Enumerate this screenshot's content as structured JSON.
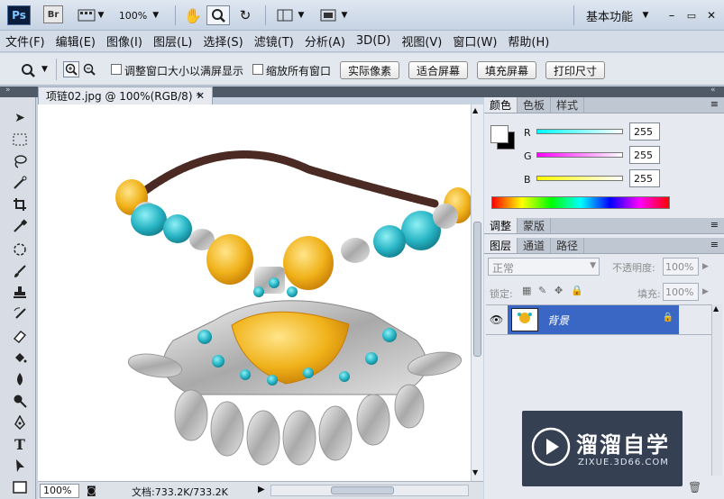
{
  "titlebar": {
    "ps_logo": "Ps",
    "br_logo": "Br",
    "zoom_value": "100%",
    "workspace_label": "基本功能",
    "window_controls": [
      "–",
      "▭",
      "✕"
    ]
  },
  "menu": [
    "文件(F)",
    "编辑(E)",
    "图像(I)",
    "图层(L)",
    "选择(S)",
    "滤镜(T)",
    "分析(A)",
    "3D(D)",
    "视图(V)",
    "窗口(W)",
    "帮助(H)"
  ],
  "options": {
    "resize_windows_label": "调整窗口大小以满屏显示",
    "zoom_all_label": "缩放所有窗口",
    "actual_pixels": "实际像素",
    "fit_screen": "适合屏幕",
    "fill_screen": "填充屏幕",
    "print_size": "打印尺寸"
  },
  "document": {
    "tab_title": "项链02.jpg @ 100%(RGB/8) *",
    "zoom": "100%",
    "doc_info": "文档:733.2K/733.2K"
  },
  "color_panel": {
    "tabs": [
      "颜色",
      "色板",
      "样式"
    ],
    "channels": [
      {
        "label": "R",
        "value": "255"
      },
      {
        "label": "G",
        "value": "255"
      },
      {
        "label": "B",
        "value": "255"
      }
    ]
  },
  "adjust_panel": {
    "tabs": [
      "调整",
      "蒙版"
    ]
  },
  "layers_panel": {
    "tabs": [
      "图层",
      "通道",
      "路径"
    ],
    "blend_mode": "正常",
    "opacity_label": "不透明度:",
    "opacity_value": "100%",
    "lock_label": "锁定:",
    "fill_label": "填充:",
    "fill_value": "100%",
    "layer_name": "背景"
  },
  "watermark": {
    "brand": "溜溜自学",
    "url": "ZIXUE.3D66.COM"
  },
  "colors": {
    "accent_layer": "#3a66c4",
    "turquoise": "#27b4c4",
    "amber": "#f0b21a"
  }
}
